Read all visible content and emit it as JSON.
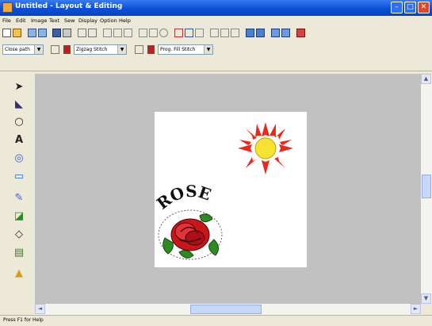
{
  "window": {
    "title": "Untitled - Layout & Editing",
    "controls": {
      "minimize": "–",
      "maximize": "□",
      "close": "✕"
    }
  },
  "menu": [
    "File",
    "Edit",
    "Image",
    "Text",
    "Sew",
    "Display",
    "Option",
    "Help"
  ],
  "toolbar": {
    "icons": [
      "new-file-icon",
      "open-folder-icon",
      "import-icon",
      "export-icon",
      "save-icon",
      "print-icon",
      "undo-icon",
      "redo-icon",
      "cut-icon",
      "copy-icon",
      "paste-icon",
      "grid-icon",
      "mirror-icon",
      "rotate-icon",
      "fit-icon",
      "zoom-icon",
      "layout-icon",
      "stitch-icon",
      "text-icon",
      "align-icon",
      "sew-order-icon",
      "preview-icon",
      "design-center-icon",
      "design-property-icon",
      "help-icon"
    ]
  },
  "properties": {
    "sew_type": "Close path",
    "line_sew": "Zigzag Stitch",
    "region_sew": "Prog. Fill Stitch",
    "line_color": "#cc1a1a",
    "region_color": "#cc1a1a"
  },
  "canvas": {
    "background": "#c1c1c1",
    "page_color": "#ffffff",
    "text_design": "ROSE",
    "sun_colors": {
      "rays": "#e8291b",
      "center": "#f6e232"
    },
    "rose_colors": {
      "petals": "#c8161d",
      "leaves": "#2f8a22"
    }
  },
  "scroll": {
    "left": "◄",
    "right": "►",
    "up": "▲",
    "down": "▼"
  },
  "status": "Press F1 for Help"
}
